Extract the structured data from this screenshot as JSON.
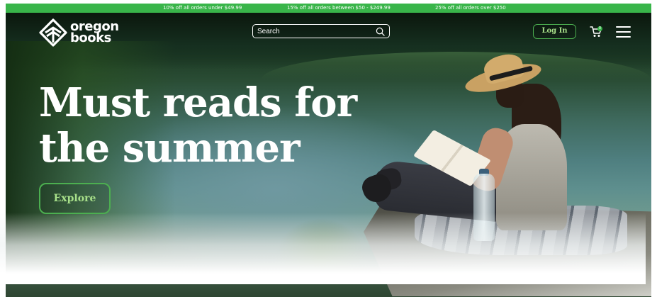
{
  "promo_bar": {
    "items": [
      "10% off all orders under $49.99",
      "15% off all orders between $50 - $249.99",
      "25% off all orders over $250"
    ]
  },
  "header": {
    "logo": {
      "line1": "oregon",
      "line2": "books",
      "icon": "book-diamond-icon"
    },
    "search": {
      "placeholder": "Search",
      "value": "",
      "icon": "search-icon"
    },
    "login_label": "Log In",
    "cart": {
      "icon": "cart-icon",
      "count": "0"
    },
    "menu_icon": "hamburger-menu-icon"
  },
  "hero": {
    "headline_line1": "Must reads for",
    "headline_line2": "the summer",
    "cta_label": "Explore"
  },
  "colors": {
    "brand_green": "#39b54a",
    "button_border": "#4caf50",
    "button_text": "#a8e08a"
  }
}
